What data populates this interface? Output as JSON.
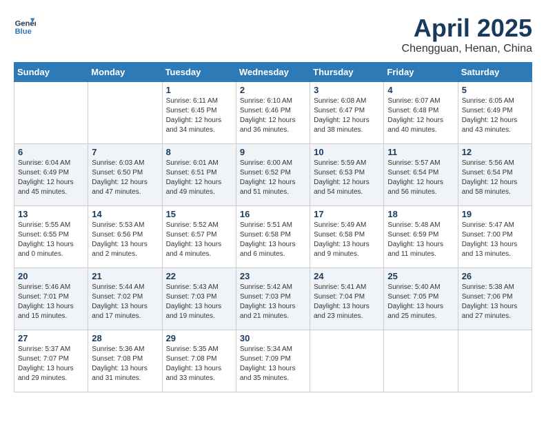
{
  "header": {
    "logo_line1": "General",
    "logo_line2": "Blue",
    "month": "April 2025",
    "location": "Chengguan, Henan, China"
  },
  "weekdays": [
    "Sunday",
    "Monday",
    "Tuesday",
    "Wednesday",
    "Thursday",
    "Friday",
    "Saturday"
  ],
  "weeks": [
    [
      {
        "day": "",
        "info": ""
      },
      {
        "day": "",
        "info": ""
      },
      {
        "day": "1",
        "info": "Sunrise: 6:11 AM\nSunset: 6:45 PM\nDaylight: 12 hours\nand 34 minutes."
      },
      {
        "day": "2",
        "info": "Sunrise: 6:10 AM\nSunset: 6:46 PM\nDaylight: 12 hours\nand 36 minutes."
      },
      {
        "day": "3",
        "info": "Sunrise: 6:08 AM\nSunset: 6:47 PM\nDaylight: 12 hours\nand 38 minutes."
      },
      {
        "day": "4",
        "info": "Sunrise: 6:07 AM\nSunset: 6:48 PM\nDaylight: 12 hours\nand 40 minutes."
      },
      {
        "day": "5",
        "info": "Sunrise: 6:05 AM\nSunset: 6:49 PM\nDaylight: 12 hours\nand 43 minutes."
      }
    ],
    [
      {
        "day": "6",
        "info": "Sunrise: 6:04 AM\nSunset: 6:49 PM\nDaylight: 12 hours\nand 45 minutes."
      },
      {
        "day": "7",
        "info": "Sunrise: 6:03 AM\nSunset: 6:50 PM\nDaylight: 12 hours\nand 47 minutes."
      },
      {
        "day": "8",
        "info": "Sunrise: 6:01 AM\nSunset: 6:51 PM\nDaylight: 12 hours\nand 49 minutes."
      },
      {
        "day": "9",
        "info": "Sunrise: 6:00 AM\nSunset: 6:52 PM\nDaylight: 12 hours\nand 51 minutes."
      },
      {
        "day": "10",
        "info": "Sunrise: 5:59 AM\nSunset: 6:53 PM\nDaylight: 12 hours\nand 54 minutes."
      },
      {
        "day": "11",
        "info": "Sunrise: 5:57 AM\nSunset: 6:54 PM\nDaylight: 12 hours\nand 56 minutes."
      },
      {
        "day": "12",
        "info": "Sunrise: 5:56 AM\nSunset: 6:54 PM\nDaylight: 12 hours\nand 58 minutes."
      }
    ],
    [
      {
        "day": "13",
        "info": "Sunrise: 5:55 AM\nSunset: 6:55 PM\nDaylight: 13 hours\nand 0 minutes."
      },
      {
        "day": "14",
        "info": "Sunrise: 5:53 AM\nSunset: 6:56 PM\nDaylight: 13 hours\nand 2 minutes."
      },
      {
        "day": "15",
        "info": "Sunrise: 5:52 AM\nSunset: 6:57 PM\nDaylight: 13 hours\nand 4 minutes."
      },
      {
        "day": "16",
        "info": "Sunrise: 5:51 AM\nSunset: 6:58 PM\nDaylight: 13 hours\nand 6 minutes."
      },
      {
        "day": "17",
        "info": "Sunrise: 5:49 AM\nSunset: 6:58 PM\nDaylight: 13 hours\nand 9 minutes."
      },
      {
        "day": "18",
        "info": "Sunrise: 5:48 AM\nSunset: 6:59 PM\nDaylight: 13 hours\nand 11 minutes."
      },
      {
        "day": "19",
        "info": "Sunrise: 5:47 AM\nSunset: 7:00 PM\nDaylight: 13 hours\nand 13 minutes."
      }
    ],
    [
      {
        "day": "20",
        "info": "Sunrise: 5:46 AM\nSunset: 7:01 PM\nDaylight: 13 hours\nand 15 minutes."
      },
      {
        "day": "21",
        "info": "Sunrise: 5:44 AM\nSunset: 7:02 PM\nDaylight: 13 hours\nand 17 minutes."
      },
      {
        "day": "22",
        "info": "Sunrise: 5:43 AM\nSunset: 7:03 PM\nDaylight: 13 hours\nand 19 minutes."
      },
      {
        "day": "23",
        "info": "Sunrise: 5:42 AM\nSunset: 7:03 PM\nDaylight: 13 hours\nand 21 minutes."
      },
      {
        "day": "24",
        "info": "Sunrise: 5:41 AM\nSunset: 7:04 PM\nDaylight: 13 hours\nand 23 minutes."
      },
      {
        "day": "25",
        "info": "Sunrise: 5:40 AM\nSunset: 7:05 PM\nDaylight: 13 hours\nand 25 minutes."
      },
      {
        "day": "26",
        "info": "Sunrise: 5:38 AM\nSunset: 7:06 PM\nDaylight: 13 hours\nand 27 minutes."
      }
    ],
    [
      {
        "day": "27",
        "info": "Sunrise: 5:37 AM\nSunset: 7:07 PM\nDaylight: 13 hours\nand 29 minutes."
      },
      {
        "day": "28",
        "info": "Sunrise: 5:36 AM\nSunset: 7:08 PM\nDaylight: 13 hours\nand 31 minutes."
      },
      {
        "day": "29",
        "info": "Sunrise: 5:35 AM\nSunset: 7:08 PM\nDaylight: 13 hours\nand 33 minutes."
      },
      {
        "day": "30",
        "info": "Sunrise: 5:34 AM\nSunset: 7:09 PM\nDaylight: 13 hours\nand 35 minutes."
      },
      {
        "day": "",
        "info": ""
      },
      {
        "day": "",
        "info": ""
      },
      {
        "day": "",
        "info": ""
      }
    ]
  ]
}
